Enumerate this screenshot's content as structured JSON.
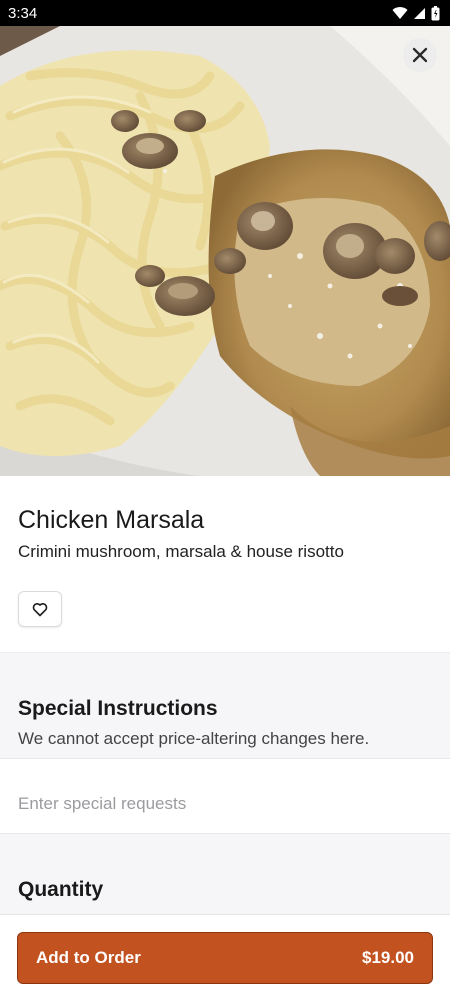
{
  "status_bar": {
    "time": "3:34"
  },
  "item": {
    "name": "Chicken Marsala",
    "description": "Crimini mushroom, marsala & house risotto"
  },
  "special_instructions": {
    "title": "Special Instructions",
    "subtitle": "We cannot accept price-altering changes here.",
    "placeholder": "Enter special requests"
  },
  "quantity": {
    "title": "Quantity"
  },
  "order_button": {
    "label": "Add to Order",
    "price": "$19.00"
  },
  "colors": {
    "accent": "#c2521f",
    "section_bg": "#f6f5f8"
  },
  "icons": [
    "wifi-icon",
    "signal-icon",
    "battery-icon",
    "close-icon",
    "heart-icon"
  ]
}
